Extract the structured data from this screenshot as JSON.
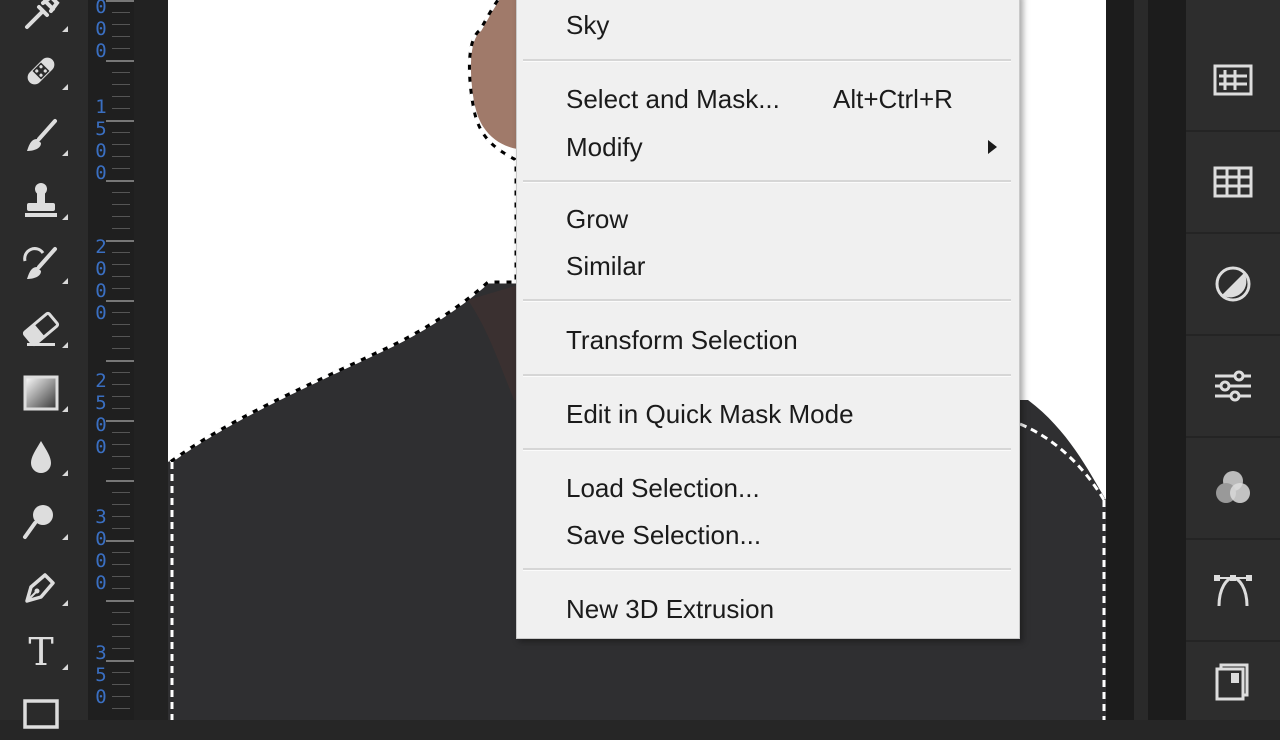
{
  "toolbar": {
    "tools": [
      {
        "icon": "eyedropper-icon"
      },
      {
        "icon": "healing-brush-icon"
      },
      {
        "icon": "brush-icon"
      },
      {
        "icon": "clone-stamp-icon"
      },
      {
        "icon": "history-brush-icon"
      },
      {
        "icon": "eraser-icon"
      },
      {
        "icon": "gradient-icon"
      },
      {
        "icon": "blur-drop-icon"
      },
      {
        "icon": "dodge-icon"
      },
      {
        "icon": "pen-icon"
      },
      {
        "icon": "type-icon",
        "glyph": "T"
      },
      {
        "icon": "rectangle-icon"
      }
    ]
  },
  "ruler": {
    "labels": [
      "000",
      "1500",
      "2000",
      "2500",
      "3000",
      "350"
    ],
    "color": "#3a6fc2"
  },
  "context_menu": {
    "items": [
      {
        "label": "Sky"
      },
      {
        "label": "Select and Mask...",
        "shortcut": "Alt+Ctrl+R"
      },
      {
        "label": "Modify",
        "submenu": true
      },
      {
        "label": "Grow"
      },
      {
        "label": "Similar"
      },
      {
        "label": "Transform Selection"
      },
      {
        "label": "Edit in Quick Mask Mode"
      },
      {
        "label": "Load Selection..."
      },
      {
        "label": "Save Selection..."
      },
      {
        "label": "New 3D Extrusion"
      }
    ]
  },
  "panel_dock": {
    "buttons": [
      {
        "icon": "glyphs-icon"
      },
      {
        "icon": "table-grid-icon"
      },
      {
        "icon": "adjustments-icon"
      },
      {
        "icon": "properties-sliders-icon"
      },
      {
        "icon": "channels-icon"
      },
      {
        "icon": "paths-icon"
      },
      {
        "icon": "layer-comps-icon"
      }
    ]
  }
}
